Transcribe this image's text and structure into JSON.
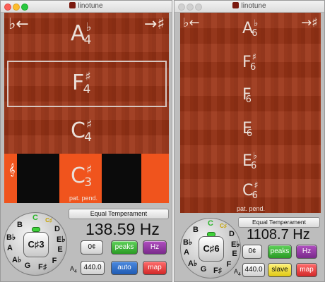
{
  "windows": [
    {
      "title": "linotune",
      "flat_label": "♭←",
      "sharp_label": "→♯",
      "notes": [
        {
          "letter": "A",
          "acc": "♭",
          "oct": "4"
        },
        {
          "letter": "F",
          "acc": "♯",
          "oct": "4"
        },
        {
          "letter": "C",
          "acc": "♯",
          "oct": "4"
        },
        {
          "letter": "C",
          "acc": "♯",
          "oct": "3"
        }
      ],
      "pat_pend": "pat. pend.",
      "temperament": "Equal Temperament",
      "frequency": "138.59 Hz",
      "dial_center": "C♯3",
      "cents": "0¢",
      "peaks": "peaks",
      "hz": "Hz",
      "a4_label": "A",
      "a4_sub": "4",
      "a4_freq": "440.0",
      "mode": "auto",
      "map": "map"
    },
    {
      "title": "linotune",
      "flat_label": "♭←",
      "sharp_label": "→♯",
      "notes": [
        {
          "letter": "A",
          "acc": "♭",
          "oct": "6"
        },
        {
          "letter": "F",
          "acc": "♯",
          "oct": "6"
        },
        {
          "letter": "F",
          "acc": "",
          "oct": "6"
        },
        {
          "letter": "E",
          "acc": "",
          "oct": "6"
        },
        {
          "letter": "E",
          "acc": "♭",
          "oct": "6"
        },
        {
          "letter": "C",
          "acc": "♯",
          "oct": "6"
        }
      ],
      "pat_pend": "pat. pend.",
      "temperament": "Equal Temperament",
      "frequency": "1108.7 Hz",
      "dial_center": "C♯6",
      "cents": "0¢",
      "peaks": "peaks",
      "hz": "Hz",
      "a4_label": "A",
      "a4_sub": "4",
      "a4_freq": "440.0",
      "mode": "slave",
      "map": "map"
    }
  ],
  "dial_notes": [
    "C",
    "C♯",
    "D",
    "E♭",
    "E",
    "F",
    "F♯",
    "G",
    "A♭",
    "A",
    "B♭",
    "B"
  ],
  "colors": {
    "tuner_bg": "#9b3416",
    "meter_orange": "#f0541d",
    "led_green": "#3fd13a"
  }
}
